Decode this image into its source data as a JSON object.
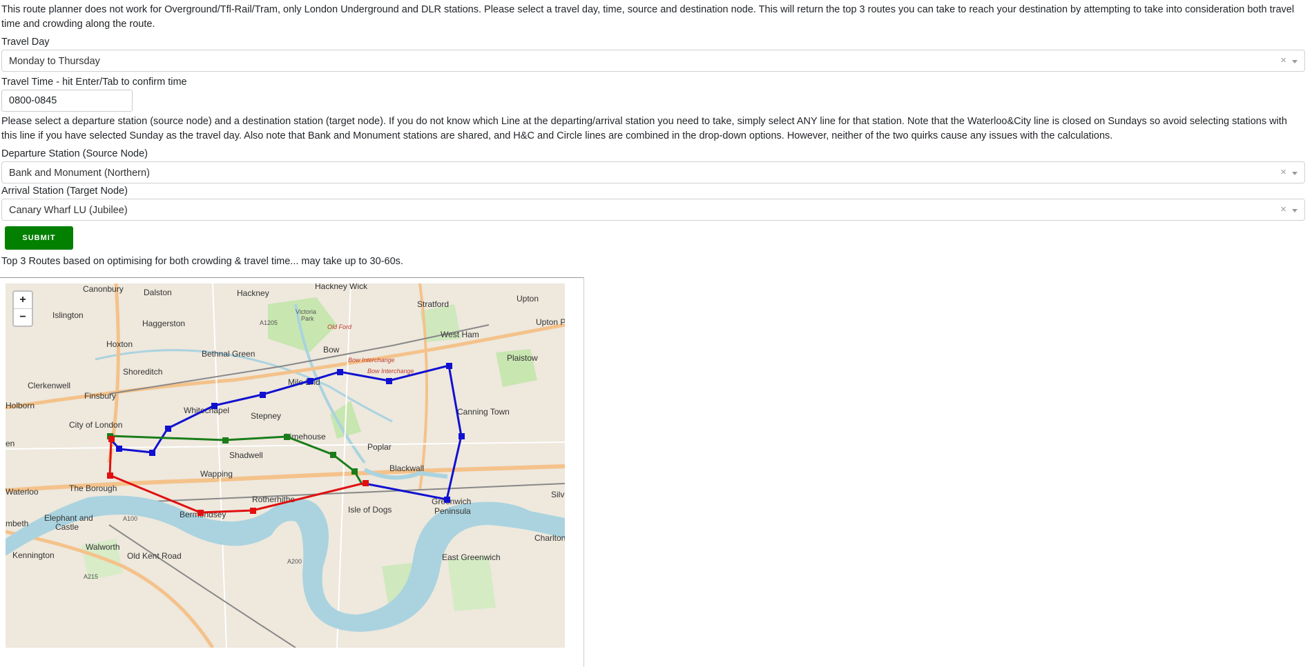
{
  "intro_text": "This route planner does not work for Overground/Tfl-Rail/Tram, only London Underground and DLR stations. Please select a travel day, time, source and destination node. This will return the top 3 routes you can take to reach your destination by attempting to take into consideration both travel time and crowding along the route.",
  "travel_day": {
    "label": "Travel Day",
    "value": "Monday to Thursday",
    "clear": "×"
  },
  "travel_time": {
    "label": "Travel Time - hit Enter/Tab to confirm time",
    "value": "0800-0845"
  },
  "instructions_text": "Please select a departure station (source node) and a destination station (target node). If you do not know which Line at the departing/arrival station you need to take, simply select ANY line for that station. Note that the Waterloo&City line is closed on Sundays so avoid selecting stations with this line if you have selected Sunday as the travel day. Also note that Bank and Monument stations are shared, and H&C and Circle lines are combined in the drop-down options. However, neither of the two quirks cause any issues with the calculations.",
  "departure": {
    "label": "Departure Station (Source Node)",
    "value": "Bank and Monument (Northern)",
    "clear": "×"
  },
  "arrival": {
    "label": "Arrival Station (Target Node)",
    "value": "Canary Wharf LU (Jubilee)",
    "clear": "×"
  },
  "submit_label": "SUBMIT",
  "results_label": "Top 3 Routes based on optimising for both crowding & travel time... may take up to 30-60s.",
  "map": {
    "zoom_in": "+",
    "zoom_out": "−",
    "places": {
      "canonbury": "Canonbury",
      "dalston": "Dalston",
      "hackney": "Hackney",
      "hackney_wick": "Hackney Wick",
      "islington": "Islington",
      "haggerston": "Haggerston",
      "stratford": "Stratford",
      "upton": "Upton",
      "upton_park": "Upton Par",
      "hoxton": "Hoxton",
      "bethnal_green": "Bethnal Green",
      "bow": "Bow",
      "west_ham": "West Ham",
      "plaistow": "Plaistow",
      "shoreditch": "Shoreditch",
      "clerkenwell": "Clerkenwell",
      "mile_end": "Mile End",
      "finsbury": "Finsbury",
      "whitechapel": "Whitechapel",
      "canning_town": "Canning Town",
      "holborn": "Holborn",
      "stepney": "Stepney",
      "city_of_london": "City of London",
      "limehouse": "Limehouse",
      "shadwell": "Shadwell",
      "poplar": "Poplar",
      "blackwall": "Blackwall",
      "wapping": "Wapping",
      "waterloo": "Waterloo",
      "the_borough": "The Borough",
      "rotherhithe": "Rotherhithe",
      "isle_of_dogs": "Isle of Dogs",
      "greenwich_peninsula_1": "Greenwich",
      "greenwich_peninsula_2": "Peninsula",
      "silvertown": "Silve",
      "bermondsey": "Bermondsey",
      "elephant_1": "Elephant and",
      "elephant_2": "Castle",
      "walworth": "Walworth",
      "kennington": "Kennington",
      "old_kent_road": "Old Kent Road",
      "east_greenwich": "East Greenwich",
      "charlton": "Charlton",
      "lambeth": "mbeth",
      "en": "en",
      "victoria_park_1": "Victoria",
      "victoria_park_2": "Park"
    },
    "roads": {
      "a1205": "A1205",
      "a100": "A100",
      "a200": "A200",
      "a215": "A215"
    },
    "red_labels": {
      "old_ford": "Old Ford",
      "bow_interchange_1": "Bow Interchange",
      "bow_interchange_2": "Bow Interchange"
    }
  },
  "colors": {
    "route_blue": "#1010d0",
    "route_green": "#1a7d1a",
    "route_red": "#e01010",
    "submit_bg": "#038000",
    "river": "#aad3df",
    "park": "#c8e6b0"
  }
}
